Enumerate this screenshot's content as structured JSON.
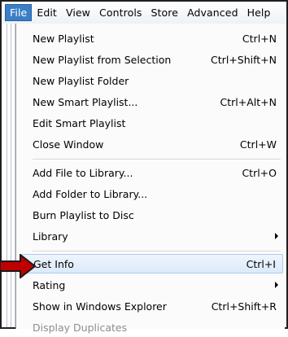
{
  "menubar": {
    "items": [
      "File",
      "Edit",
      "View",
      "Controls",
      "Store",
      "Advanced",
      "Help"
    ],
    "active": "File"
  },
  "file_menu": {
    "items": [
      {
        "label": "New Playlist",
        "shortcut": "Ctrl+N"
      },
      {
        "label": "New Playlist from Selection",
        "shortcut": "Ctrl+Shift+N"
      },
      {
        "label": "New Playlist Folder",
        "shortcut": ""
      },
      {
        "label": "New Smart Playlist...",
        "shortcut": "Ctrl+Alt+N"
      },
      {
        "label": "Edit Smart Playlist",
        "shortcut": ""
      },
      {
        "label": "Close Window",
        "shortcut": "Ctrl+W"
      },
      {
        "label": "Add File to Library...",
        "shortcut": "Ctrl+O"
      },
      {
        "label": "Add Folder to Library...",
        "shortcut": ""
      },
      {
        "label": "Burn Playlist to Disc",
        "shortcut": ""
      },
      {
        "label": "Library",
        "shortcut": ""
      },
      {
        "label": "Get Info",
        "shortcut": "Ctrl+I"
      },
      {
        "label": "Rating",
        "shortcut": ""
      },
      {
        "label": "Show in Windows Explorer",
        "shortcut": "Ctrl+Shift+R"
      },
      {
        "label": "Display Duplicates",
        "shortcut": ""
      }
    ],
    "highlighted": "Get Info",
    "disabled": [
      "Display Duplicates"
    ],
    "submenus": [
      "Library",
      "Rating"
    ]
  },
  "annotation": {
    "arrow_color": "#c00000",
    "arrow_icon": "red-pointer-arrow"
  }
}
